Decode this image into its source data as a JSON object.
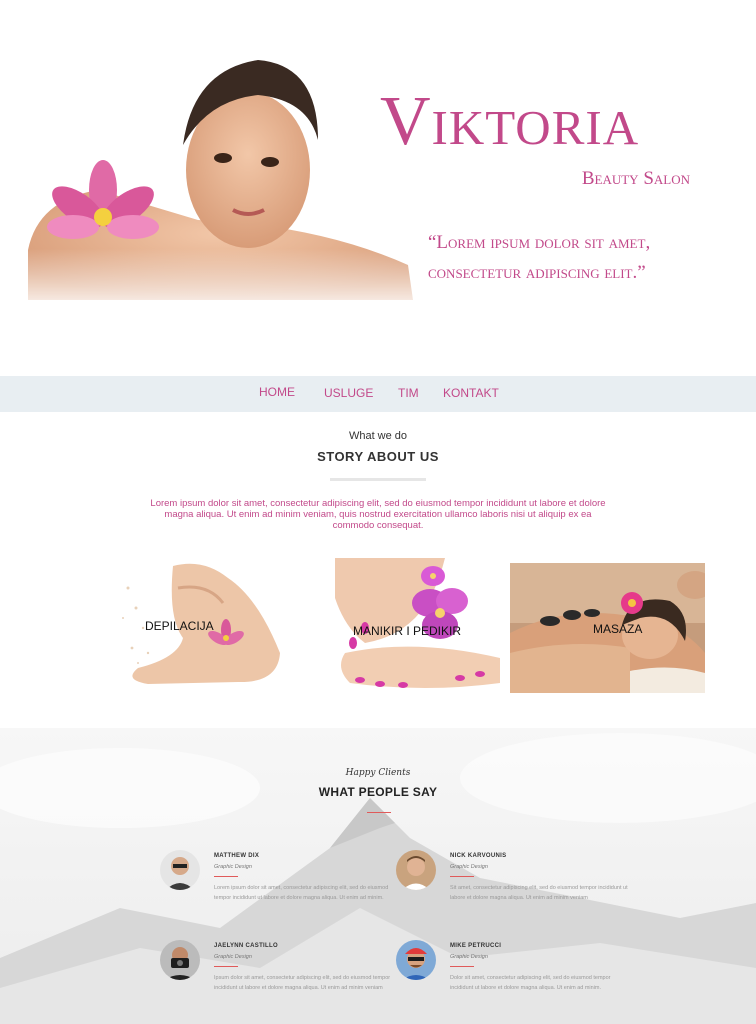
{
  "hero": {
    "brand": "Viktoria",
    "tagline": "Beauty Salon",
    "quote": "“Lorem ipsum dolor sit amet, consectetur adipiscing elit.”"
  },
  "nav": {
    "items": [
      {
        "label": "HOME"
      },
      {
        "label": "USLUGE"
      },
      {
        "label": "TIM"
      },
      {
        "label": "KONTAKT"
      }
    ]
  },
  "about": {
    "kicker": "What we do",
    "title": "STORY ABOUT US",
    "text": "Lorem ipsum dolor sit amet, consectetur adipiscing elit, sed do eiusmod tempor incididunt ut labore et dolore magna aliqua. Ut enim ad minim veniam, quis nostrud exercitation ullamco laboris nisi ut aliquip ex ea commodo consequat."
  },
  "services": [
    {
      "label": "DEPILACIJA"
    },
    {
      "label": "MANIKIR I PEDIKIR"
    },
    {
      "label": "MASAZA"
    }
  ],
  "testimonials": {
    "kicker": "Happy Clients",
    "title": "WHAT PEOPLE SAY",
    "items": [
      {
        "name": "MATTHEW DIX",
        "role": "Graphic Design",
        "text": "Lorem ipsum dolor sit amet, consectetur adipiscing elit, sed do eiusmod tempor incididunt ut labore et dolore magna aliqua. Ut enim ad minim."
      },
      {
        "name": "NICK KARVOUNIS",
        "role": "Graphic Design",
        "text": "Sit amet, consectetur adipiscing elit, sed do eiusmod tempor incididunt ut labore et dolore magna aliqua. Ut enim ad minim veniam"
      },
      {
        "name": "JAELYNN CASTILLO",
        "role": "Graphic Design",
        "text": "Ipsum dolor sit amet, consectetur adipiscing elit, sed do eiusmod tempor incididunt ut labore et dolore magna aliqua. Ut enim ad minim veniam"
      },
      {
        "name": "MIKE PETRUCCI",
        "role": "Graphic Design",
        "text": "Dolor sit amet, consectetur adipiscing elit, sed do eiusmod tempor incididunt ut labore et dolore magna aliqua. Ut enim ad minim."
      }
    ]
  },
  "colors": {
    "accent": "#c2498a",
    "nav_bg": "#e8eef2",
    "rule": "#e05a5a"
  }
}
